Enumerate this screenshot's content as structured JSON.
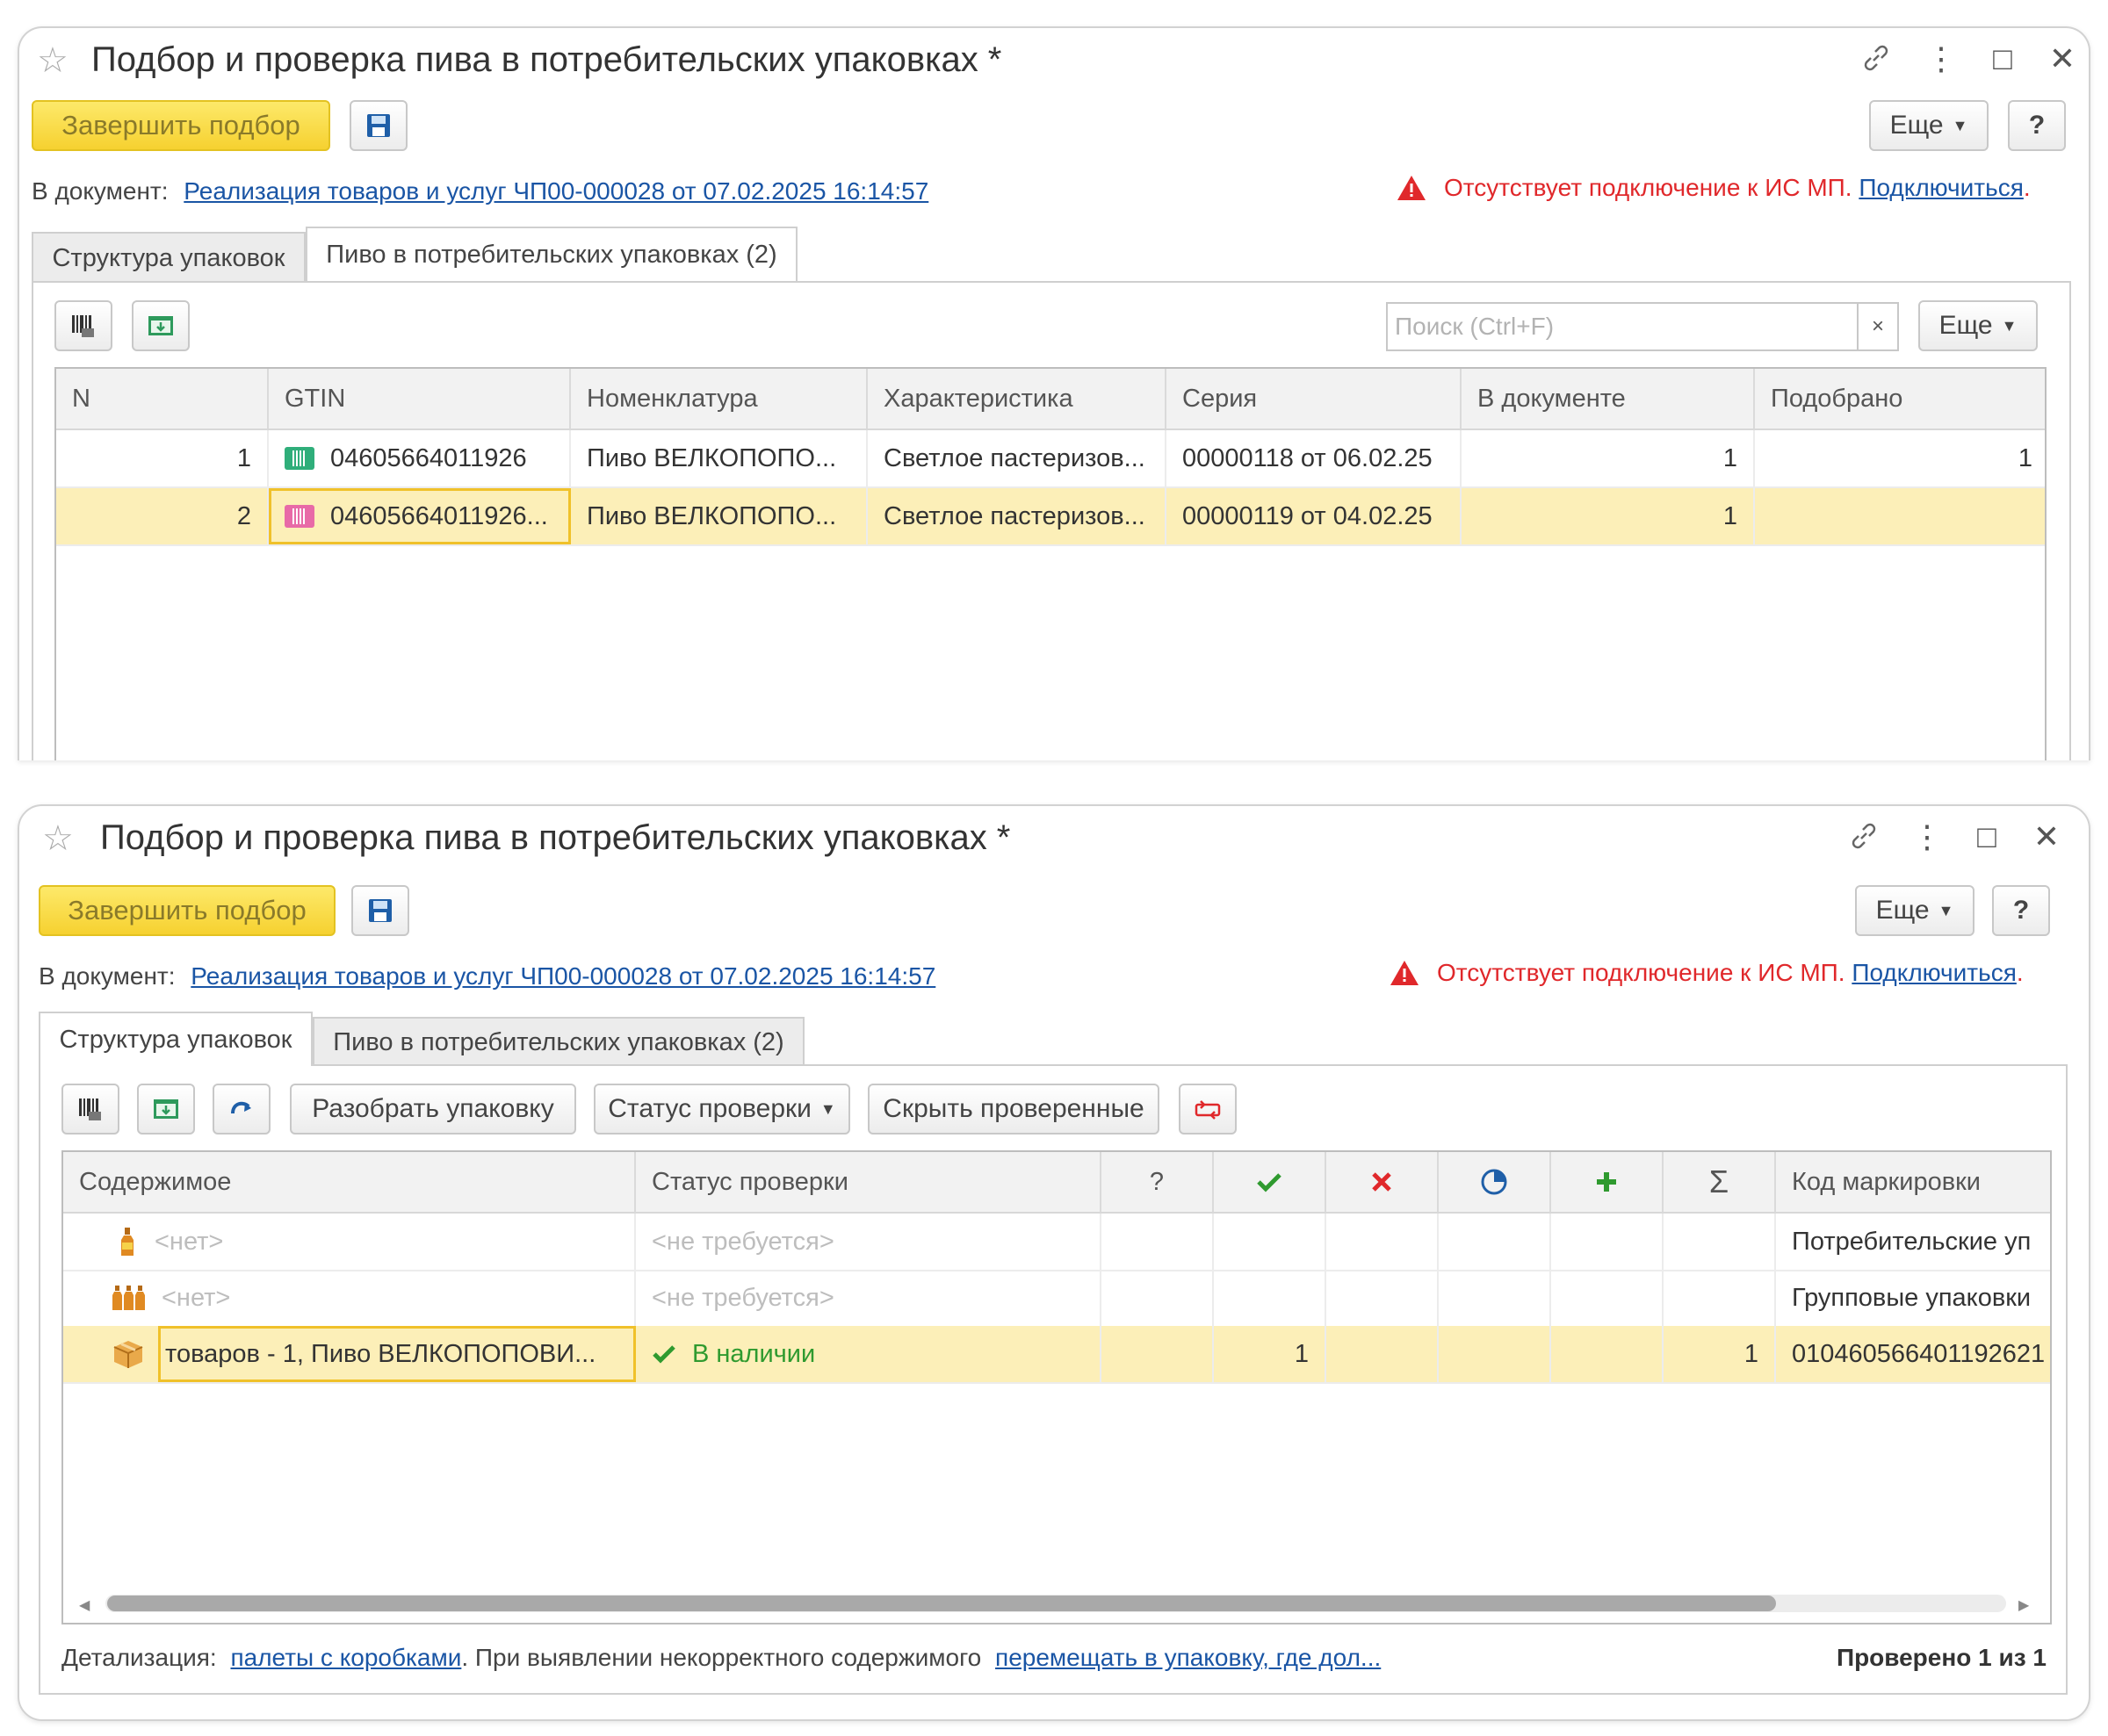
{
  "window_top": {
    "title": "Подбор и проверка пива в потребительских упаковках *",
    "finish_button": "Завершить подбор",
    "more_button": "Еще",
    "help_button": "?",
    "doc_label": "В документ:",
    "doc_link": "Реализация товаров и услуг ЧП00-000028 от 07.02.2025 16:14:57",
    "warning_text": "Отсутствует подключение к ИС МП.",
    "connect_link": "Подключиться",
    "connect_suffix": ".",
    "tabs": [
      "Структура упаковок",
      "Пиво в потребительских упаковках (2)"
    ],
    "active_tab": 1,
    "search_placeholder": "Поиск (Ctrl+F)",
    "search_clear": "×",
    "table_more_button": "Еще",
    "columns": [
      "N",
      "GTIN",
      "Номенклатура",
      "Характеристика",
      "Серия",
      "В документе",
      "Подобрано"
    ],
    "rows": [
      {
        "n": "1",
        "gtin": "04605664011926",
        "nomenclature": "Пиво ВЕЛКОПОПО...",
        "characteristic": "Светлое пастеризов...",
        "series": "00000118 от 06.02.25",
        "in_doc": "1",
        "picked": "1",
        "icon": "datamatrix-green-icon"
      },
      {
        "n": "2",
        "gtin": "04605664011926...",
        "nomenclature": "Пиво ВЕЛКОПОПО...",
        "characteristic": "Светлое пастеризов...",
        "series": "00000119 от 04.02.25",
        "in_doc": "1",
        "picked": "",
        "icon": "datamatrix-pink-icon"
      }
    ]
  },
  "window_bottom": {
    "title": "Подбор и проверка пива в потребительских упаковках *",
    "finish_button": "Завершить подбор",
    "more_button": "Еще",
    "help_button": "?",
    "doc_label": "В документ:",
    "doc_link": "Реализация товаров и услуг ЧП00-000028 от 07.02.2025 16:14:57",
    "warning_text": "Отсутствует подключение к ИС МП.",
    "connect_link": "Подключиться",
    "connect_suffix": ".",
    "tabs": [
      "Структура упаковок",
      "Пиво в потребительских упаковках (2)"
    ],
    "active_tab": 0,
    "toolbar": {
      "unpack_button": "Разобрать упаковку",
      "status_button": "Статус проверки",
      "hide_checked_button": "Скрыть проверенные"
    },
    "columns": [
      "Содержимое",
      "Статус проверки",
      "?",
      "",
      "",
      "",
      "",
      "Σ",
      "Код маркировки"
    ],
    "rows": [
      {
        "content": "<нет>",
        "status": "<не требуется>",
        "code": "Потребительские уп",
        "icon": "bottle-icon"
      },
      {
        "content": "<нет>",
        "status": "<не требуется>",
        "code": "Групповые упаковки",
        "icon": "bottles-group-icon"
      },
      {
        "content": "товаров - 1, Пиво ВЕЛКОПОПОВИ...",
        "status": "В наличии",
        "q": "",
        "ok": "1",
        "err": "",
        "pend": "",
        "add": "",
        "sum": "1",
        "code": "010460566401192621",
        "icon": "box-icon"
      }
    ],
    "footer": {
      "detail_label": "Детализация:",
      "detail_link": "палеты с коробками",
      "middle_text": ". При выявлении некорректного содержимого",
      "move_link": "перемещать в упаковку, где дол...",
      "checked_text": "Проверено 1 из 1"
    }
  },
  "colors": {
    "accent_yellow": "#f6d130",
    "selected_row": "#fcefb8",
    "link": "#1a55a5",
    "warning": "#e0282b",
    "ok_green": "#2f9a2f"
  }
}
